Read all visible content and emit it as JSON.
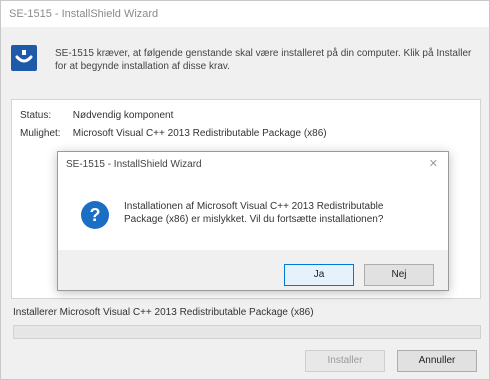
{
  "window": {
    "title": "SE-1515 - InstallShield Wizard"
  },
  "header": {
    "description": "SE-1515 kræver, at følgende genstande skal være installeret på din computer. Klik på Installer for at begynde installation af disse krav."
  },
  "panel": {
    "status_label": "Status:",
    "status_value": "Nødvendig komponent",
    "package_label": "Mulighet:",
    "package_value": "Microsoft Visual C++ 2013 Redistributable Package (x86)"
  },
  "progress": {
    "label": "Installerer Microsoft Visual C++ 2013 Redistributable Package (x86)",
    "fraction": 0
  },
  "buttons": {
    "install": "Installer",
    "cancel": "Annuller"
  },
  "dialog": {
    "title": "SE-1515 - InstallShield Wizard",
    "close_glyph": "✕",
    "message": "Installationen af Microsoft Visual C++ 2013 Redistributable Package (x86) er mislykket. Vil du fortsætte installationen?",
    "yes": "Ja",
    "no": "Nej",
    "icon": "question-icon"
  },
  "colors": {
    "accent": "#0078d7",
    "logo": "#1e5aa8"
  }
}
